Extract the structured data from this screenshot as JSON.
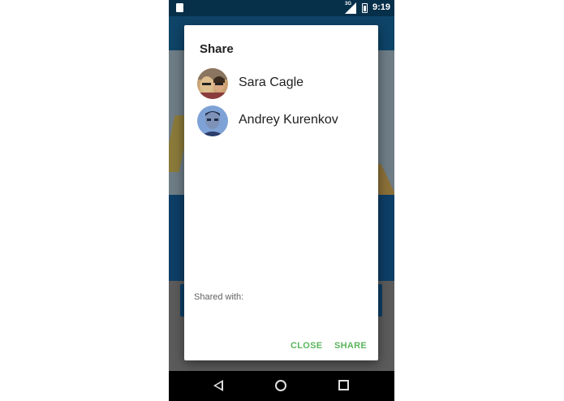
{
  "status_bar": {
    "network": "3G",
    "time": "9:19",
    "icons": [
      "sd-card-icon",
      "signal-icon",
      "battery-icon"
    ]
  },
  "dialog": {
    "title": "Share",
    "contacts": [
      {
        "name": "Sara Cagle",
        "avatar": "avatar-photo-couple"
      },
      {
        "name": "Andrey Kurenkov",
        "avatar": "avatar-photo-man"
      }
    ],
    "shared_with_label": "Shared with:",
    "close_label": "CLOSE",
    "share_label": "SHARE",
    "accent_color": "#5bb55d"
  },
  "nav_bar": {
    "icons": [
      "back-icon",
      "home-icon",
      "recents-icon"
    ]
  }
}
